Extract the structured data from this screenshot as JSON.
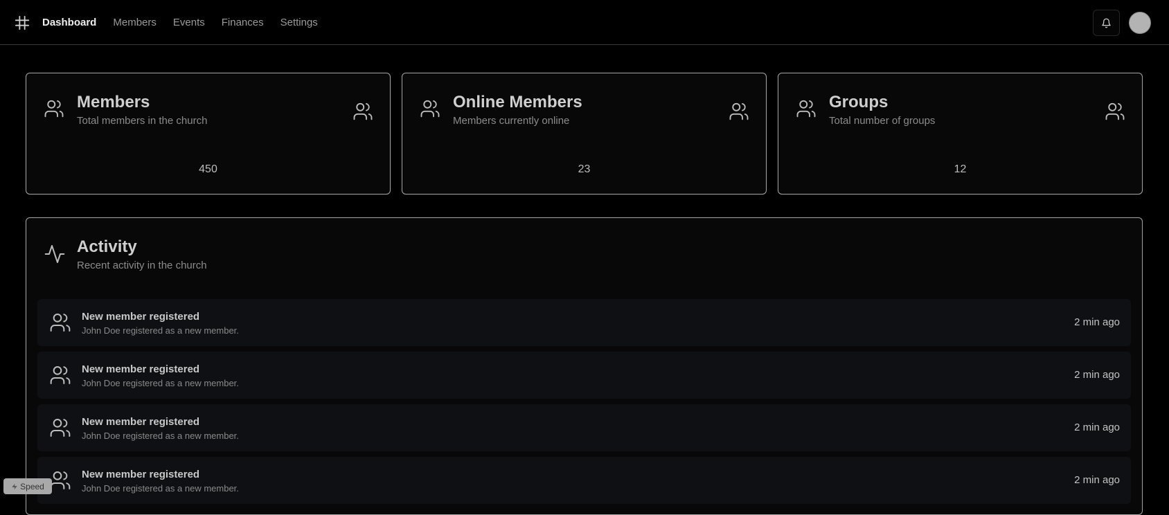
{
  "nav": {
    "items": [
      {
        "label": "Dashboard",
        "active": true
      },
      {
        "label": "Members",
        "active": false
      },
      {
        "label": "Events",
        "active": false
      },
      {
        "label": "Finances",
        "active": false
      },
      {
        "label": "Settings",
        "active": false
      }
    ]
  },
  "stats": [
    {
      "title": "Members",
      "description": "Total members in the church",
      "value": "450",
      "icon": "users-icon"
    },
    {
      "title": "Online Members",
      "description": "Members currently online",
      "value": "23",
      "icon": "users-icon"
    },
    {
      "title": "Groups",
      "description": "Total number of groups",
      "value": "12",
      "icon": "users-icon"
    }
  ],
  "activity": {
    "title": "Activity",
    "description": "Recent activity in the church",
    "icon": "activity-icon",
    "items": [
      {
        "title": "New member registered",
        "description": "John Doe registered as a new member.",
        "time": "2 min ago",
        "icon": "users-icon"
      },
      {
        "title": "New member registered",
        "description": "John Doe registered as a new member.",
        "time": "2 min ago",
        "icon": "users-icon"
      },
      {
        "title": "New member registered",
        "description": "John Doe registered as a new member.",
        "time": "2 min ago",
        "icon": "users-icon"
      },
      {
        "title": "New member registered",
        "description": "John Doe registered as a new member.",
        "time": "2 min ago",
        "icon": "users-icon"
      }
    ]
  },
  "speed_badge": {
    "label": "Speed",
    "icon": "lightning-icon"
  },
  "colors": {
    "background": "#000000",
    "card_border": "#a8a8a8",
    "row_background": "#0e1014",
    "avatar": "#b3b3b3"
  }
}
